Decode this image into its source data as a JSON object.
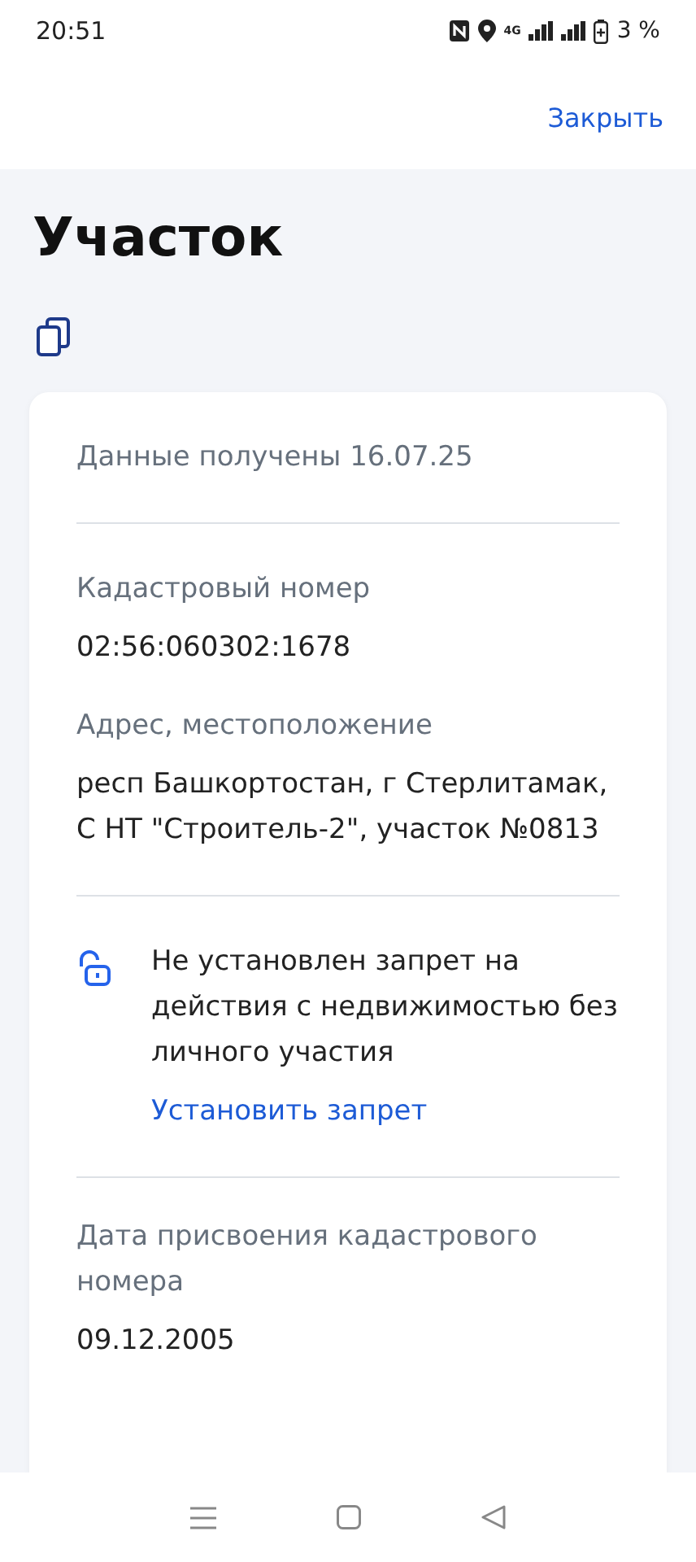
{
  "status_bar": {
    "time": "20:51",
    "network": "4G",
    "battery": "3 %"
  },
  "close": "Закрыть",
  "title": "Участок",
  "card": {
    "received": "Данные получены 16.07.25",
    "fields": [
      {
        "label": "Кадастровый номер",
        "value": "02:56:060302:1678"
      },
      {
        "label": "Адрес, местоположение",
        "value": "респ Башкортостан, г Стерлитамак, С НТ \"Строитель-2\", участок №0813"
      }
    ],
    "ban": {
      "locked": false,
      "text": "Не установлен запрет на действия с недвижимостью без личного участия",
      "link": "Установить запрет"
    },
    "fields2": [
      {
        "label": "Дата присвоения кадастрового номера",
        "value": "09.12.2005"
      }
    ]
  }
}
